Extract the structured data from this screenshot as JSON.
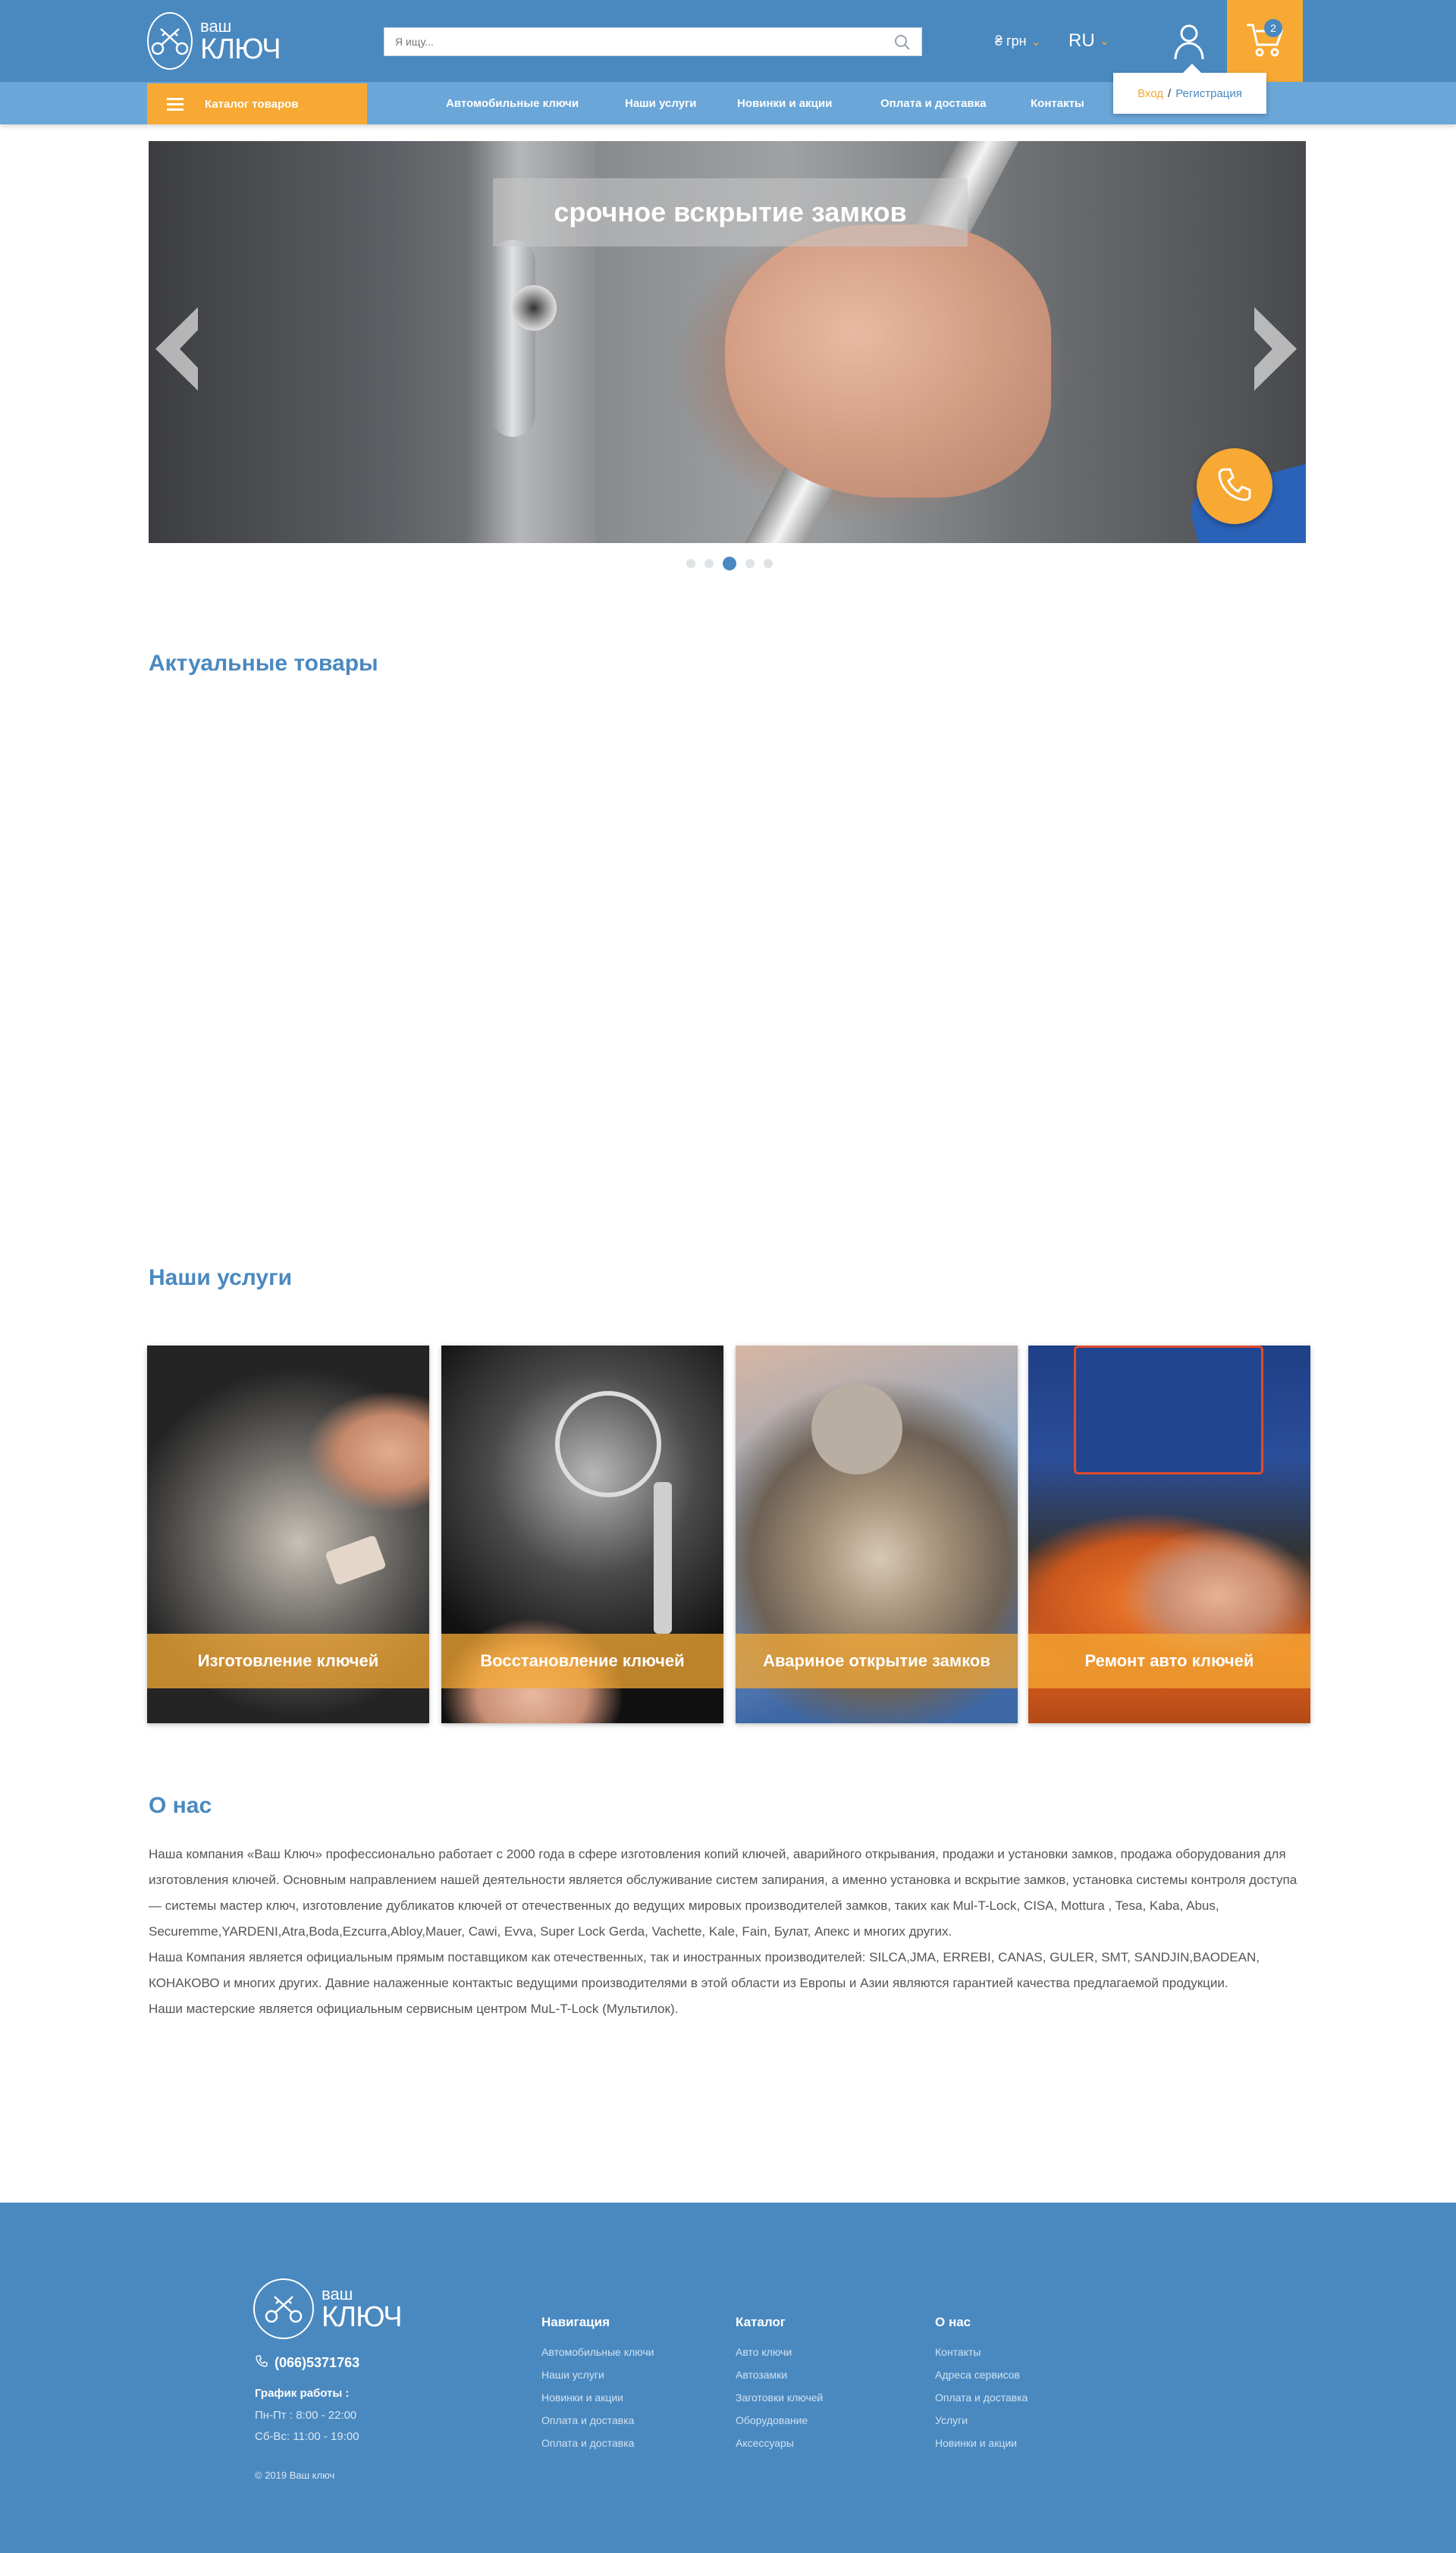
{
  "header": {
    "logo_line1": "ваш",
    "logo_line2": "КЛЮЧ",
    "search_placeholder": "Я ищу...",
    "currency": "₴ грн",
    "language": "RU",
    "cart_count": "2",
    "auth_login": "Вход",
    "auth_separator": "/",
    "auth_register": "Регистрация"
  },
  "nav": {
    "catalog_label": "Каталог товаров",
    "links": [
      "Автомобильные ключи",
      "Наши услуги",
      "Новинки и акции",
      "Оплата и доставка",
      "Контакты"
    ]
  },
  "slider": {
    "caption": "срочное вскрытие замков",
    "dots_total": 5,
    "active_dot": 3
  },
  "sections": {
    "actual_title": "Актуальные товары",
    "services_title": "Наши услуги",
    "about_title": "О нас"
  },
  "services": [
    "Изготовление ключей",
    "Восстановление ключей",
    "Авариное открытие замков",
    "Ремонт авто ключей"
  ],
  "about": {
    "paragraphs": [
      "Наша компания «Ваш Ключ» профессионально работает с 2000 года в сфере изготовления копий ключей, аварийного открывания, продажи  и установки замков, продажа оборудования для изготовления ключей. Основным направлением нашей деятельности является обслуживание систем запирания, а именно установка и вскрытие замков, установка системы контроля доступа — системы мастер ключ, изготовление дубликатов ключей от отечественных до ведущих мировых производителей замков, таких как Mul-T-Lock,  CISA,  Mottura , Tesa, Kaba, Abus, Securemme,YARDENI,Atra,Boda,Ezcurra,Abloy,Mauer, Cawi, Evva, Super Lock  Gerda, Vachette, Kale, Fain, Булат, Апекс и многих других.",
      "Наша Компания является официальным прямым поставщиком как отечественных, так и иностранных производителей: SILCA,JMA, ERREBI, CANAS, GULER, SMT, SANDJIN,BAODEAN, КОНАКОВО и многих других. Давние налаженные контактыс ведущими производителями в этой области из Европы и Азии являются гарантией качества предлагаемой продукции.",
      "Наши мастерские является официальным сервисным центром MuL-T-Lock (Мультилок)."
    ]
  },
  "footer": {
    "logo_line1": "ваш",
    "logo_line2": "КЛЮЧ",
    "phone": "(066)5371763",
    "schedule_title": "График работы :",
    "schedule": [
      "Пн-Пт : 8:00 - 22:00",
      "Сб-Вс: 11:00 - 19:00"
    ],
    "copyright": "© 2019 Ваш ключ",
    "columns": [
      {
        "title": "Навигация",
        "items": [
          "Автомобильные ключи",
          "Наши услуги",
          "Новинки и акции",
          "Оплата и доставка",
          "Оплата и доставка"
        ]
      },
      {
        "title": "Каталог",
        "items": [
          "Авто ключи",
          "Автозамки",
          "Заготовки ключей",
          "Оборудование",
          "Аксессуары"
        ]
      },
      {
        "title": "О нас",
        "items": [
          "Контакты",
          "Адреса сервисов",
          "Оплата и доставка",
          "Услуги",
          "Новинки и акции"
        ]
      }
    ]
  },
  "colors": {
    "brand_blue": "#4a89c0",
    "nav_blue": "#6aa6d8",
    "accent_orange": "#f7a933"
  }
}
